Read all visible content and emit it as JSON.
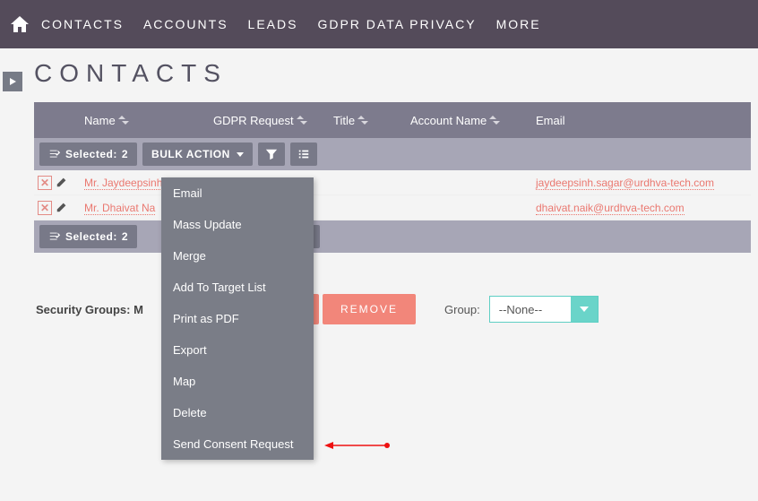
{
  "nav": {
    "items": [
      "CONTACTS",
      "ACCOUNTS",
      "LEADS",
      "GDPR DATA PRIVACY",
      "MORE"
    ]
  },
  "page": {
    "title": "CONTACTS"
  },
  "columns": {
    "name": "Name",
    "gdpr": "GDPR Request",
    "title": "Title",
    "account": "Account Name",
    "email": "Email"
  },
  "toolbar": {
    "selected_label": "Selected:",
    "selected_count": "2",
    "bulk_action": "BULK ACTION"
  },
  "rows": [
    {
      "name": "Mr. Jaydeepsinh",
      "email": "jaydeepsinh.sagar@urdhva-tech.com"
    },
    {
      "name": "Mr. Dhaivat Na",
      "email": "dhaivat.naik@urdhva-tech.com"
    }
  ],
  "toolbar2": {
    "selected_label": "Selected:",
    "selected_count": "2"
  },
  "dropdown": {
    "items": [
      "Email",
      "Mass Update",
      "Merge",
      "Add To Target List",
      "Print as PDF",
      "Export",
      "Map",
      "Delete",
      "Send Consent Request"
    ]
  },
  "lower": {
    "security_groups": "Security Groups: M",
    "remove": "REMOVE",
    "group_label": "Group:",
    "group_value": "--None--"
  }
}
